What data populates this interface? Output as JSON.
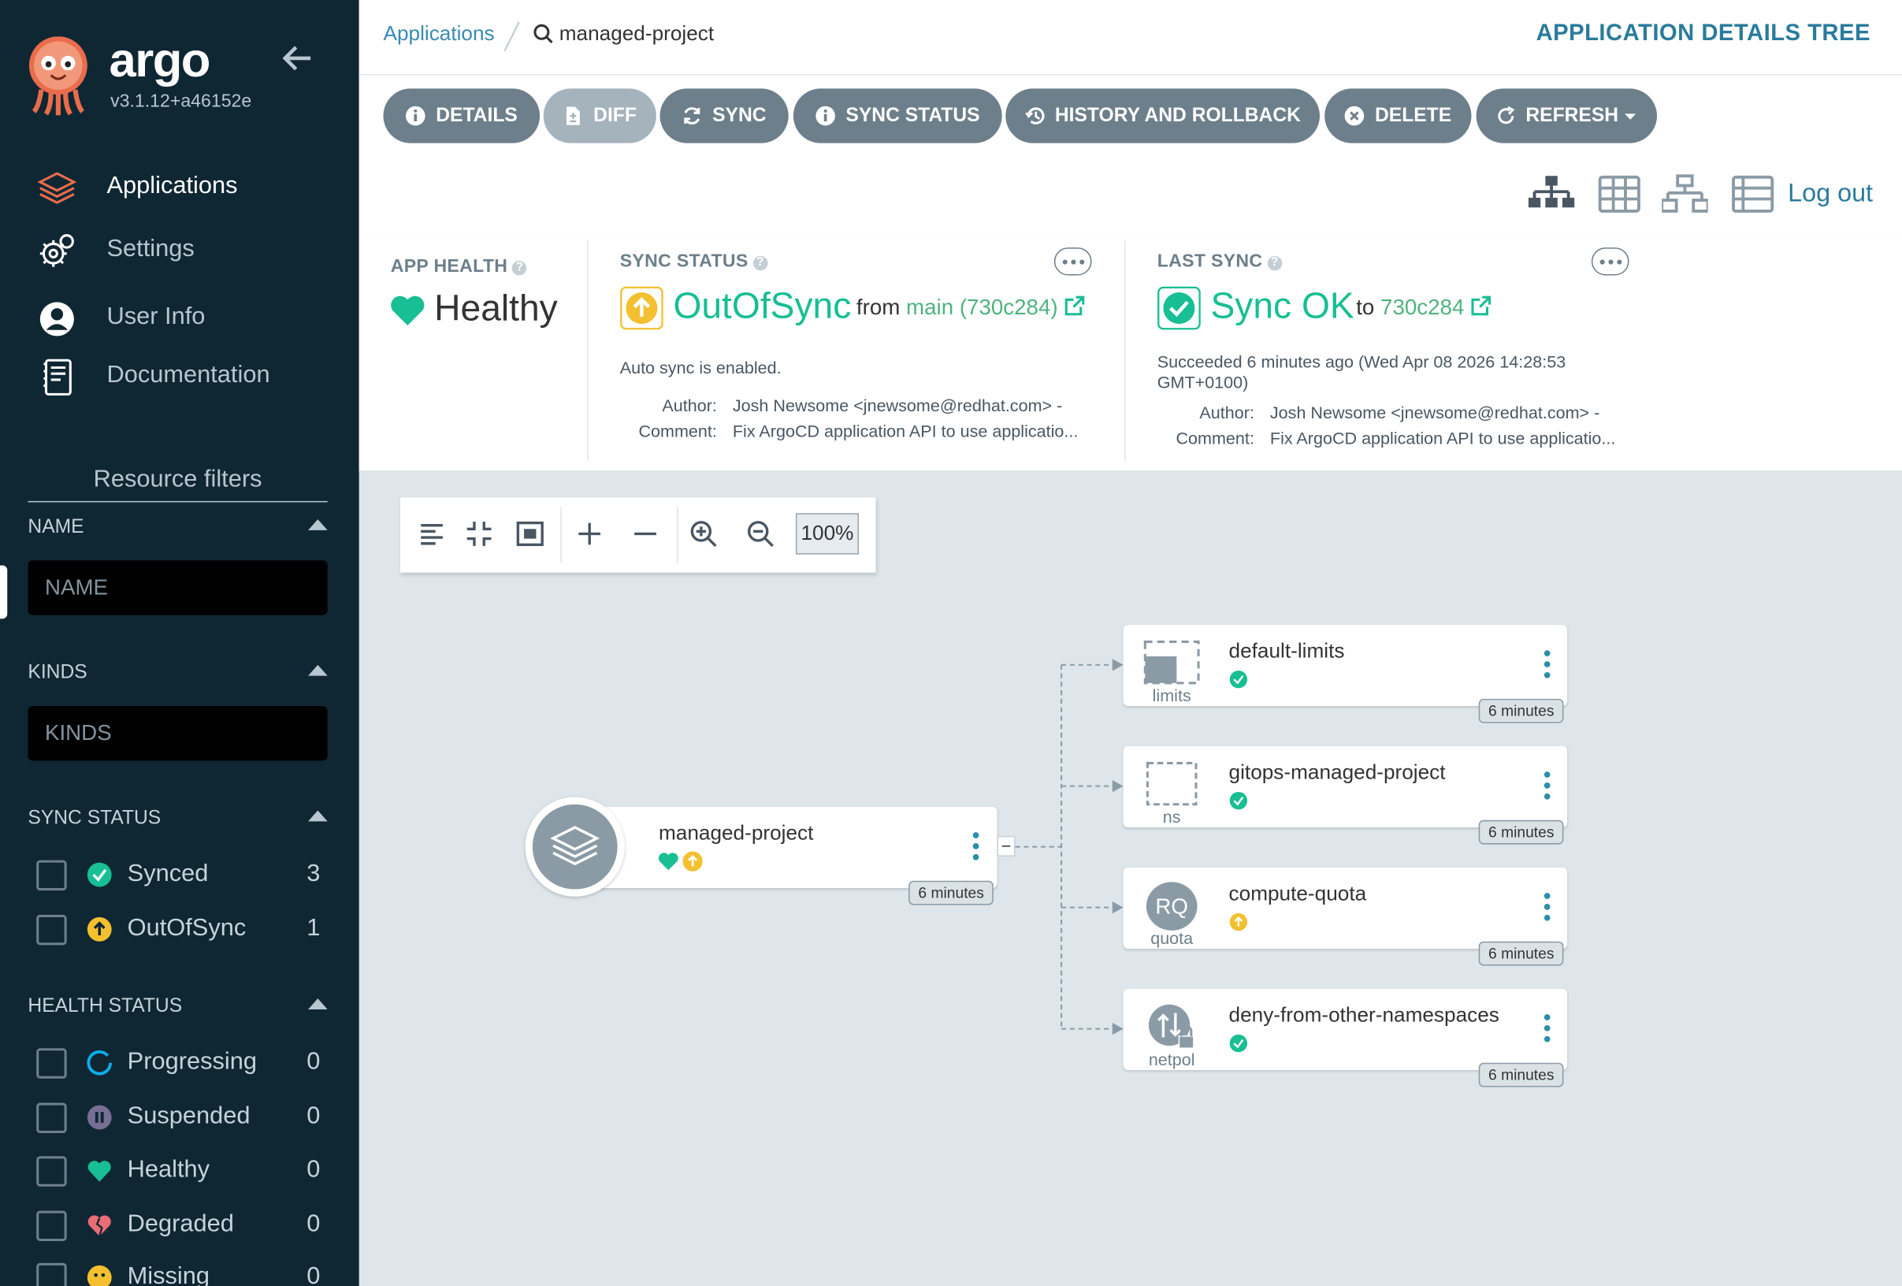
{
  "app": {
    "brand": "argo",
    "version": "v3.1.12+a46152e"
  },
  "nav": [
    {
      "label": "Applications",
      "icon": "layers-icon",
      "active": true
    },
    {
      "label": "Settings",
      "icon": "gears-icon"
    },
    {
      "label": "User Info",
      "icon": "user-circle-icon"
    },
    {
      "label": "Documentation",
      "icon": "book-icon"
    }
  ],
  "filters": {
    "title": "Resource filters",
    "name": {
      "heading": "NAME",
      "placeholder": "NAME"
    },
    "kinds": {
      "heading": "KINDS",
      "placeholder": "KINDS"
    },
    "sync_status": {
      "heading": "SYNC STATUS",
      "items": [
        {
          "label": "Synced",
          "count": "3",
          "icon": "check-circle-icon"
        },
        {
          "label": "OutOfSync",
          "count": "1",
          "icon": "arrow-up-circle-icon"
        }
      ]
    },
    "health_status": {
      "heading": "HEALTH STATUS",
      "items": [
        {
          "label": "Progressing",
          "count": "0",
          "icon": "progress-ring-icon"
        },
        {
          "label": "Suspended",
          "count": "0",
          "icon": "pause-circle-icon"
        },
        {
          "label": "Healthy",
          "count": "0",
          "icon": "heart-icon"
        },
        {
          "label": "Degraded",
          "count": "0",
          "icon": "broken-heart-icon"
        },
        {
          "label": "Missing",
          "count": "0",
          "icon": "ghost-icon"
        }
      ]
    }
  },
  "breadcrumb": {
    "root": "Applications",
    "current": "managed-project"
  },
  "page_title": "APPLICATION DETAILS TREE",
  "toolbar": {
    "details": "DETAILS",
    "diff": "DIFF",
    "sync": "SYNC",
    "sync_status": "SYNC STATUS",
    "history": "HISTORY AND ROLLBACK",
    "delete": "DELETE",
    "refresh": "REFRESH",
    "logout": "Log out"
  },
  "app_health": {
    "title": "APP HEALTH",
    "value": "Healthy",
    "color": "#18be94"
  },
  "sync_status": {
    "title": "SYNC STATUS",
    "value": "OutOfSync",
    "from_label": "from",
    "revision": "main (730c284)",
    "auto_sync": "Auto sync is enabled.",
    "author_label": "Author:",
    "author": "Josh Newsome <jnewsome@redhat.com> -",
    "comment_label": "Comment:",
    "comment": "Fix ArgoCD application API to use applicatio..."
  },
  "last_sync": {
    "title": "LAST SYNC",
    "value": "Sync OK",
    "to_label": "to",
    "revision": "730c284",
    "succeeded_line1": "Succeeded 6 minutes ago (Wed Apr 08 2026 14:28:53",
    "succeeded_line2": "GMT+0100)",
    "author_label": "Author:",
    "author": "Josh Newsome <jnewsome@redhat.com> -",
    "comment_label": "Comment:",
    "comment": "Fix ArgoCD application API to use applicatio..."
  },
  "graph": {
    "zoom": "100%",
    "root": {
      "name": "managed-project",
      "age": "6 minutes",
      "collapse": "−"
    },
    "resources": [
      {
        "name": "default-limits",
        "kind": "limits",
        "status": "synced",
        "age": "6 minutes"
      },
      {
        "name": "gitops-managed-project",
        "kind": "ns",
        "status": "synced",
        "age": "6 minutes"
      },
      {
        "name": "compute-quota",
        "kind": "quota",
        "kind_abbr": "RQ",
        "status": "out-of-sync",
        "age": "6 minutes"
      },
      {
        "name": "deny-from-other-namespaces",
        "kind": "netpol",
        "status": "synced",
        "age": "6 minutes"
      }
    ]
  },
  "colors": {
    "sidebar": "#0f2733",
    "synced": "#18be94",
    "out_of_sync": "#f4c030",
    "link": "#2a7b9c",
    "button": "#6d7f8b"
  }
}
